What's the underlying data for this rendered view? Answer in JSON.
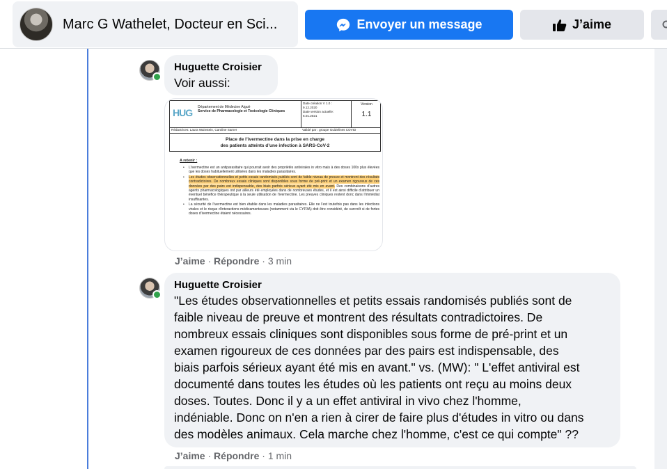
{
  "header": {
    "profile_name": "Marc G Wathelet, Docteur en Sci...",
    "message_button": "Envoyer un message",
    "like_button": "J’aime",
    "icons": {
      "message": "messenger-icon",
      "like": "thumbs-up-icon",
      "search": "search-icon"
    },
    "colors": {
      "primary": "#1877f2",
      "secondary_bg": "#e4e6eb"
    }
  },
  "comments": [
    {
      "author": "Huguette Croisier",
      "text": "Voir aussi:",
      "like_label": "J’aime",
      "reply_label": "Répondre",
      "time": "3 min",
      "attachment": {
        "dept": "Département de Médecine Aiguë",
        "service": "Service de Pharmacologie et Toxicologie Cliniques",
        "logo": "HUG",
        "logo_sub": "Hôpitaux Universitaires Genève",
        "date_creation": "Date création V 1.0 :",
        "date_creation_val": "9.12.2020",
        "date_actuelle": "Date version actuelle:",
        "date_actuelle_val": "6.01.2021",
        "version_label": "Version",
        "version_num": "1.1",
        "authors": "Rédactrices: Laura Wainstein, Caroline Samer",
        "validated": "Validé par : groupe Guidelines COVID",
        "title_line1": "Place de l’ivermectine dans la prise en charge",
        "title_line2": "des patients atteints d’une infection à SARS-CoV-2",
        "retenir": "A retenir :",
        "bullet1": "L’ivermectine est un antiparasitaire qui pourrait avoir des propriétés antivirales in vitro mais à des doses 100x plus élevées que les doses habituellement utilisées dans les maladies parasitaires.",
        "bullet2_highlight": "Les études observationnelles et petits essais randomisés publiés sont de faible niveau de preuve et montrent des résultats contradictoires. De nombreux essais cliniques sont disponibles sous forme de pré-print et un examen rigoureux de ces données par des pairs est indispensable, des biais parfois sérieux ayant été mis en avant.",
        "bullet2_rest": " Des combinaisons d’autres agents pharmacologiques ont par ailleurs été employées dans de nombreuses études, et il est ainsi difficile d’attribuer un éventuel bénéfice thérapeutique à la seule utilisation de l’ivermectine. Les preuves cliniques restent donc dans l’immédiat insuffisantes.",
        "bullet3": "La sécurité de l’ivermectine est bien établie dans les maladies parasitaires. Elle ne l’est toutefois pas dans les infections virales et le risque d’interactions médicamenteuses (notamment via le CYP3A) doit être considéré, de surcroît si de fortes doses d’ivermectine étaient nécessaires."
      }
    },
    {
      "author": "Huguette Croisier",
      "lines": [
        "\"Les études observationnelles et petits essais randomisés publiés sont de",
        "faible niveau de preuve et montrent des résultats contradictoires. De",
        "nombreux essais cliniques sont disponibles sous forme de pré-print et un",
        "examen rigoureux de ces données par des pairs est indispensable, des",
        "biais parfois sérieux ayant été mis en avant.\" vs. (MW): \" L'effet antiviral est",
        "documenté dans toutes les études où les patients ont reçu au moins deux",
        "doses. Toutes. Donc il y a un effet antiviral in vivo chez l'homme,",
        "indéniable. Donc on n'en a rien à cirer de faire plus d'études in vitro ou dans",
        "des modèles animaux. Cela marche chez l'homme, c'est ce qui compte\" ??"
      ],
      "like_label": "J’aime",
      "reply_label": "Répondre",
      "time": "1 min"
    }
  ]
}
